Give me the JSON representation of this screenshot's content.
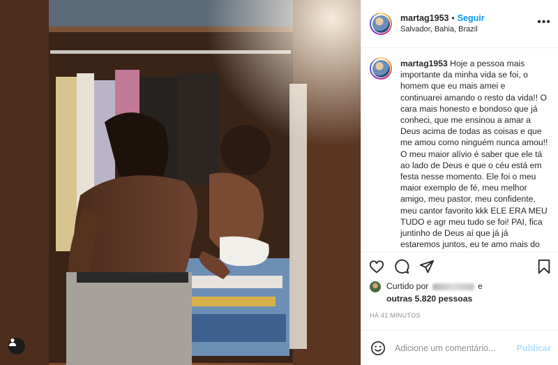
{
  "post": {
    "username": "martag1953",
    "follow_label": "Seguir",
    "separator": "•",
    "location": "Salvador, Bahia, Brazil",
    "more_label": "•••"
  },
  "caption": {
    "username": "martag1953",
    "text": "Hoje a pessoa mais importante da minha vida se foi, o homem que eu mais amei e continuarei amando o resto da vida!! O cara mais honesto e bondoso que já conheci, que me ensinou a amar a Deus acima de todas as coisas e que me amou como ninguém nunca amou!! O meu maior alívio é saber que ele tá ao lado de Deus e que o céu está em festa nesse momento. Ele foi o meu maior exemplo de fé, meu melhor amigo, meu pastor, meu confidente, meu cantor favorito kkk ELE ERA MEU TUDO e agr meu tudo se foi! PAI, fica juntinho de Deus aí que já já estaremos juntos, eu te amo mais do posso expressar e imaginar!"
  },
  "actions": {
    "icons": [
      "heart-icon",
      "comment-icon",
      "share-icon",
      "bookmark-icon"
    ]
  },
  "likes": {
    "prefix": "Curtido por",
    "conjunction": "e",
    "others": "outras 5.820 pessoas"
  },
  "timestamp": "HÁ 41 MINUTOS",
  "comment_box": {
    "placeholder": "Adicione um comentário...",
    "publish_label": "Publicar"
  },
  "colors": {
    "accent": "#0095f6",
    "publish_disabled": "#b2dffc",
    "border": "#efefef"
  }
}
